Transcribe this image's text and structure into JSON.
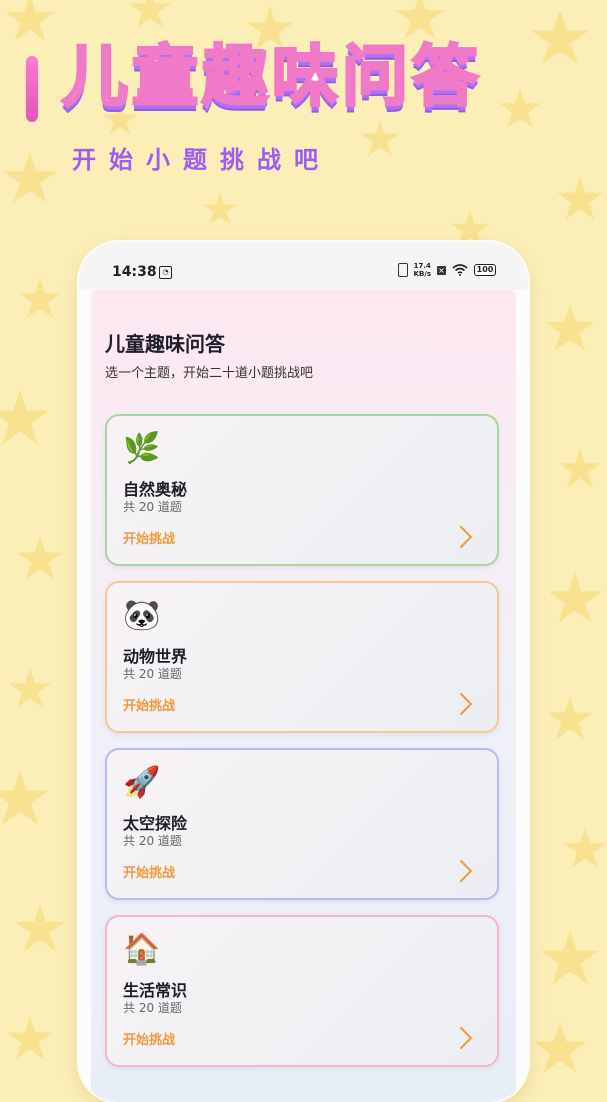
{
  "hero": {
    "title": "儿童趣味问答",
    "subtitle": "开始小题挑战吧"
  },
  "status_bar": {
    "time": "14:38",
    "net_speed_value": "17.4",
    "net_speed_unit": "KB/s",
    "battery": "100"
  },
  "page": {
    "title": "儿童趣味问答",
    "subtitle": "选一个主题，开始二十道小题挑战吧"
  },
  "topics": [
    {
      "icon": "🌿",
      "icon_name": "herb-icon",
      "title": "自然奥秘",
      "count": "共 20 道题",
      "action": "开始挑战",
      "border_color": "#a8d6a2"
    },
    {
      "icon": "🐼",
      "icon_name": "panda-icon",
      "title": "动物世界",
      "count": "共 20 道题",
      "action": "开始挑战",
      "border_color": "#f5c894"
    },
    {
      "icon": "🚀",
      "icon_name": "rocket-icon",
      "title": "太空探险",
      "count": "共 20 道题",
      "action": "开始挑战",
      "border_color": "#b7b9f2"
    },
    {
      "icon": "🏠",
      "icon_name": "house-icon",
      "title": "生活常识",
      "count": "共 20 道题",
      "action": "开始挑战",
      "border_color": "#f5b6c6"
    }
  ],
  "colors": {
    "accent_action": "#ef9a3b",
    "hero_stroke": "#f17ac8",
    "hero_subtitle": "#9b5df2",
    "background": "#fbeeb6"
  }
}
